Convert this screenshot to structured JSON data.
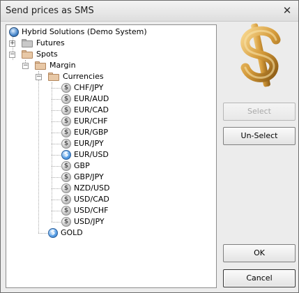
{
  "window": {
    "title": "Send prices as SMS",
    "close_icon": "close-icon"
  },
  "tree": {
    "root": {
      "label": "Hybrid Solutions (Demo System)",
      "icon": "globe-icon"
    },
    "futures": {
      "label": "Futures",
      "icon": "folder-icon",
      "expander": "+"
    },
    "spots": {
      "label": "Spots",
      "icon": "folder-open-icon",
      "expander": "−"
    },
    "margin": {
      "label": "Margin",
      "icon": "folder-open-icon",
      "expander": "−"
    },
    "currencies": {
      "label": "Currencies",
      "icon": "folder-open-icon",
      "expander": "−"
    },
    "symbols": [
      {
        "label": "CHF/JPY",
        "icon": "coin-grey-icon"
      },
      {
        "label": "EUR/AUD",
        "icon": "coin-grey-icon"
      },
      {
        "label": "EUR/CAD",
        "icon": "coin-grey-icon"
      },
      {
        "label": "EUR/CHF",
        "icon": "coin-grey-icon"
      },
      {
        "label": "EUR/GBP",
        "icon": "coin-grey-icon"
      },
      {
        "label": "EUR/JPY",
        "icon": "coin-grey-icon"
      },
      {
        "label": "EUR/USD",
        "icon": "coin-blue-icon"
      },
      {
        "label": "GBP",
        "icon": "coin-grey-icon"
      },
      {
        "label": "GBP/JPY",
        "icon": "coin-grey-icon"
      },
      {
        "label": "NZD/USD",
        "icon": "coin-grey-icon"
      },
      {
        "label": "USD/CAD",
        "icon": "coin-grey-icon"
      },
      {
        "label": "USD/CHF",
        "icon": "coin-grey-icon"
      },
      {
        "label": "USD/JPY",
        "icon": "coin-grey-icon"
      }
    ],
    "gold": {
      "label": "GOLD",
      "icon": "coin-blue-icon"
    }
  },
  "buttons": {
    "select": "Select",
    "unselect": "Un-Select",
    "ok": "OK",
    "cancel": "Cancel"
  },
  "colors": {
    "dollar_gold": "#d49a3a",
    "selected_coin": "#3d86d4"
  }
}
